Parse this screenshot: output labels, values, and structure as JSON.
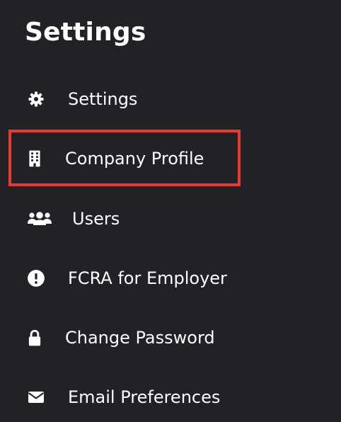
{
  "panel": {
    "title": "Settings",
    "highlight_color": "#e63b2e",
    "items": [
      {
        "label": "Settings",
        "icon": "gear-icon"
      },
      {
        "label": "Company Profile",
        "icon": "building-icon",
        "highlighted": true
      },
      {
        "label": "Users",
        "icon": "users-icon"
      },
      {
        "label": "FCRA for Employer",
        "icon": "exclamation-circle-icon"
      },
      {
        "label": "Change Password",
        "icon": "lock-icon"
      },
      {
        "label": "Email Preferences",
        "icon": "envelope-icon"
      }
    ]
  }
}
